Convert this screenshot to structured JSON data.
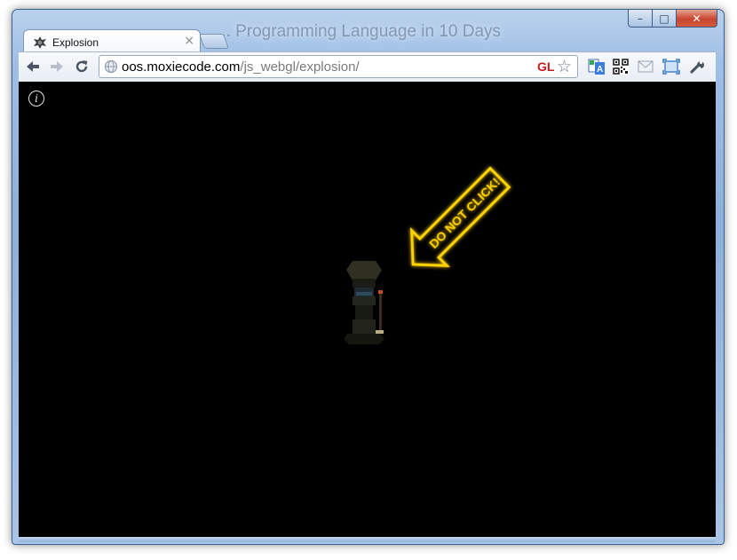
{
  "browser": {
    "background_window_title": "... Programming Language in 10 Days",
    "tab": {
      "title": "Explosion",
      "close_glyph": "×",
      "favicon": "explosion-favicon-icon"
    },
    "window_controls": {
      "minimize": "–",
      "maximize": "□",
      "close": "✕"
    },
    "nav": {
      "back_icon": "back-arrow-icon",
      "forward_icon": "forward-arrow-icon",
      "reload_icon": "reload-icon"
    },
    "omnibox": {
      "host": "oos.moxiecode.com",
      "path": "/js_webgl/explosion/",
      "gl_badge": "GL",
      "star_glyph": "☆"
    },
    "extensions": [
      "translate-icon",
      "qr-code-icon",
      "mail-icon",
      "fullscreen-icon",
      "wrench-icon"
    ]
  },
  "page": {
    "background": "#000000",
    "info_glyph": "i",
    "arrow_label": "DO NOT CLICK!",
    "arrow_color": "#ffd200"
  }
}
